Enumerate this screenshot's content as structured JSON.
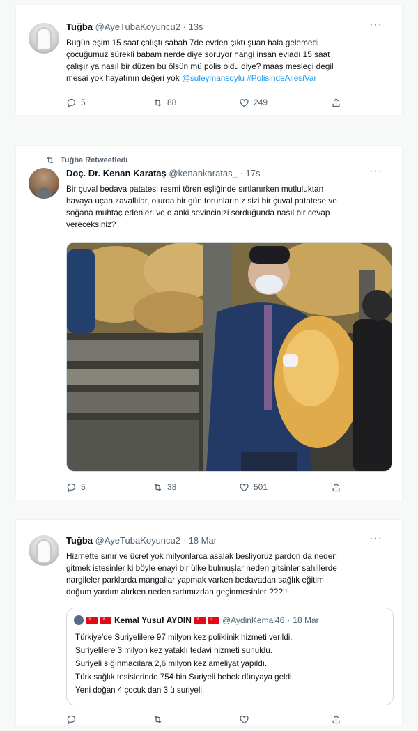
{
  "tweets": [
    {
      "name": "Tuğba",
      "handle": "@AyeTubaKoyuncu2",
      "dot": "·",
      "time": "13s",
      "more": "···",
      "lines": [
        "Bugün eşim 15 saat çalıştı sabah 7de evden çıktı şuan hala gelemedi",
        "çocuğumuz sürekli babam nerde diye soruyor hangi insan evladı 15 saat",
        "çalışır ya nasıl bir düzen bu ölsün mü polis oldu diye? maaş meslegi degil"
      ],
      "last_line_text": "mesai yok hayatının değeri yok ",
      "mention": "@suleymansoylu",
      "hashtag": "#PolisindeAilesiVar",
      "replies": "5",
      "retweets": "88",
      "likes": "249",
      "avatar_icon": "bride-avatar"
    },
    {
      "retweet_context": "Tuğba Retweetledi",
      "name": "Doç. Dr. Kenan Karataş",
      "handle": "@kenankaratas_",
      "dot": "·",
      "time": "17s",
      "more": "···",
      "lines": [
        "Bir çuval bedava patatesi resmi tören eşliğinde sırtlanırken mutluluktan",
        "havaya uçan zavallılar, olurda bir gün torunlarınız sizi bir çuval patatese ve",
        "soğana muhtaç edenleri ve o anki sevincinizi sorduğunda nasıl bir cevap",
        "vereceksiniz?"
      ],
      "replies": "5",
      "retweets": "38",
      "likes": "501",
      "avatar_icon": "man-avatar",
      "media_icon": "photo-man-carrying-potato-sack"
    },
    {
      "name": "Tuğba",
      "handle": "@AyeTubaKoyuncu2",
      "dot": "·",
      "time": "18 Mar",
      "more": "···",
      "lines": [
        "Hizmette sınır ve ücret yok milyonlarca asalak besliyoruz pardon da neden",
        "gitmek istesinler ki böyle enayi bir ülke bulmuşlar neden gitsinler sahillerde",
        "nargileler parklarda mangallar yapmak varken bedavadan sağlık eğitim",
        "doğum yardım alırken neden sırtımızdan geçinmesinler ???!!"
      ],
      "avatar_icon": "bride-avatar",
      "quote": {
        "name": "Kemal Yusuf AYDIN",
        "handle": "@AydinKemal46",
        "dot": "·",
        "time": "18 Mar",
        "lines": [
          "Türkiye'de Suriyelilere 97 milyon kez poliklinik hizmeti verildi.",
          "Suriyelilere 3 milyon kez yataklı tedavi hizmeti sunuldu.",
          "Suriyeli sığınmacılara 2,6 milyon kez ameliyat yapıldı.",
          "Türk sağlık tesislerinde 754 bin Suriyeli bebek dünyaya geldi.",
          "Yeni doğan 4 çocuk dan 3 ü suriyeli."
        ]
      }
    }
  ],
  "colors": {
    "link": "#1d9bf0",
    "muted": "#536471",
    "text": "#0f1419",
    "flag_red": "#e30a17"
  }
}
